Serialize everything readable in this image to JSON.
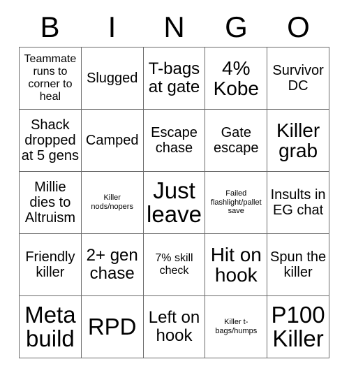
{
  "card": {
    "title": "BINGO",
    "header_letters": [
      "B",
      "I",
      "N",
      "G",
      "O"
    ],
    "grid_size": "5x5",
    "colors": {
      "background": "#ffffff",
      "text": "#000000",
      "grid_line": "#6b6b6b"
    },
    "cells": [
      {
        "text": "Teammate runs to corner to heal",
        "size": "sm"
      },
      {
        "text": "Slugged",
        "size": "md"
      },
      {
        "text": "T-bags at gate",
        "size": "lg"
      },
      {
        "text": "4% Kobe",
        "size": "xl"
      },
      {
        "text": "Survivor DC",
        "size": "md"
      },
      {
        "text": "Shack dropped at 5 gens",
        "size": "md"
      },
      {
        "text": "Camped",
        "size": "md"
      },
      {
        "text": "Escape chase",
        "size": "md"
      },
      {
        "text": "Gate escape",
        "size": "md"
      },
      {
        "text": "Killer grab",
        "size": "xl"
      },
      {
        "text": "Millie dies to Altruism",
        "size": "md"
      },
      {
        "text": "Killer nods/nopers",
        "size": "xs"
      },
      {
        "text": "Just leave",
        "size": "xxl"
      },
      {
        "text": "Failed flashlight/pallet save",
        "size": "xs"
      },
      {
        "text": "Insults in EG chat",
        "size": "md"
      },
      {
        "text": "Friendly killer",
        "size": "md"
      },
      {
        "text": "2+ gen chase",
        "size": "lg"
      },
      {
        "text": "7% skill check",
        "size": "sm"
      },
      {
        "text": "Hit on hook",
        "size": "xl"
      },
      {
        "text": "Spun the killer",
        "size": "md"
      },
      {
        "text": "Meta build",
        "size": "xxl"
      },
      {
        "text": "RPD",
        "size": "xxl"
      },
      {
        "text": "Left on hook",
        "size": "lg"
      },
      {
        "text": "Killer t-bags/humps",
        "size": "xs"
      },
      {
        "text": "P100 Killer",
        "size": "xxl"
      }
    ]
  }
}
